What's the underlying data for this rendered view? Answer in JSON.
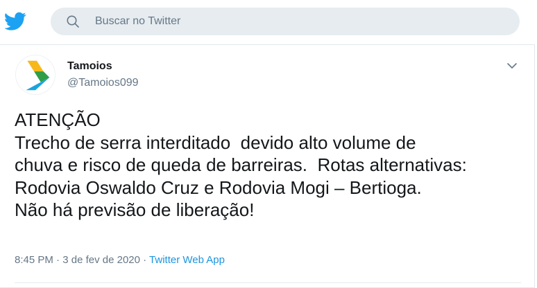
{
  "header": {
    "search": {
      "placeholder": "Buscar no Twitter"
    }
  },
  "tweet": {
    "author": {
      "name": "Tamoios",
      "handle": "@Tamoios099"
    },
    "text_lines": [
      "ATENÇÃO",
      "Trecho de serra interditado  devido alto volume de",
      "chuva e risco de queda de barreiras.  Rotas alternativas:",
      "Rodovia Oswaldo Cruz e Rodovia Mogi – Bertioga.",
      "Não há previsão de liberação!"
    ],
    "time": "8:45 PM",
    "separator": " · ",
    "date": "3 de fev de 2020",
    "source": "Twitter Web App"
  },
  "colors": {
    "brand_blue": "#1da1f2",
    "link_blue": "#1b95e0",
    "secondary_text": "#657786",
    "search_bg": "#e6ecf0"
  },
  "icons": {
    "logo": "twitter-bird-icon",
    "search": "search-icon",
    "caret": "chevron-down-icon"
  }
}
